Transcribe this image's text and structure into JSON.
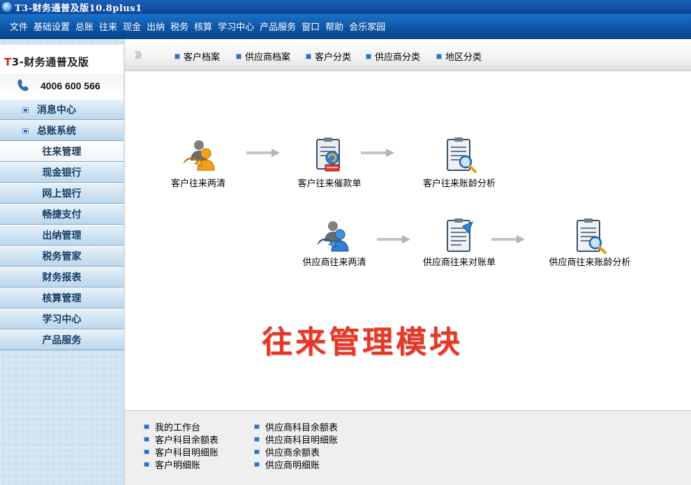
{
  "window": {
    "title": "T3-财务通普及版10.8plus1"
  },
  "menubar": {
    "items": [
      "文件",
      "基础设置",
      "总账",
      "往来",
      "现金",
      "出纳",
      "税务",
      "核算",
      "学习中心",
      "产品服务",
      "窗口",
      "帮助",
      "会乐家园"
    ]
  },
  "sidebar": {
    "logo_prefix": "T",
    "logo_rest": "3-财务通普及版",
    "phone": "4006 600 566",
    "nav": [
      {
        "label": "消息中心"
      },
      {
        "label": "总账系统"
      },
      {
        "label": "往来管理"
      },
      {
        "label": "现金银行"
      },
      {
        "label": "网上银行"
      },
      {
        "label": "畅捷支付"
      },
      {
        "label": "出纳管理"
      },
      {
        "label": "税务管家"
      },
      {
        "label": "财务报表"
      },
      {
        "label": "核算管理"
      },
      {
        "label": "学习中心"
      },
      {
        "label": "产品服务"
      }
    ]
  },
  "tabs": {
    "arrows": "》》",
    "items": [
      "客户档案",
      "供应商档案",
      "客户分类",
      "供应商分类",
      "地区分类"
    ]
  },
  "flow": {
    "customer": [
      "客户往来两清",
      "客户往来催款单",
      "客户往来账龄分析"
    ],
    "supplier": [
      "供应商往来两清",
      "供应商往来对账单",
      "供应商往来账龄分析"
    ]
  },
  "module_title": "往来管理模块",
  "bottom_links": {
    "col1": [
      "我的工作台",
      "客户科目余额表",
      "客户科目明细账",
      "客户明细账"
    ],
    "col2": [
      "供应商科目余额表",
      "供应商科目明细账",
      "供应商余额表",
      "供应商明细账"
    ]
  },
  "colors": {
    "accent": "#0b4f9e",
    "module_title": "#e23a2a",
    "arrow": "#b9b9b9"
  }
}
